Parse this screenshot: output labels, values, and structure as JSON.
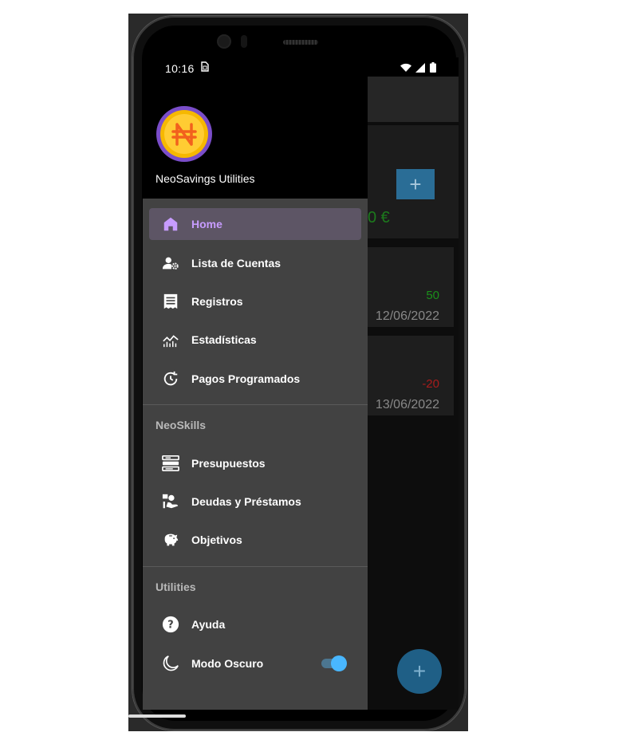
{
  "status_bar": {
    "time": "10:16",
    "sim_icon": "sim-card-icon",
    "icons": [
      "wifi-icon",
      "signal-icon",
      "battery-icon"
    ]
  },
  "drawer": {
    "app_name": "NeoSavings Utilities",
    "logo_icon": "naira-coin-icon",
    "items": [
      {
        "label": "Home",
        "icon": "home-icon",
        "active": true
      },
      {
        "label": "Lista de Cuentas",
        "icon": "accounts-settings-icon"
      },
      {
        "label": "Registros",
        "icon": "receipt-icon"
      },
      {
        "label": "Estadísticas",
        "icon": "chart-icon"
      },
      {
        "label": "Pagos Programados",
        "icon": "scheduled-clock-icon"
      }
    ],
    "sections": [
      {
        "title": "NeoSkills",
        "items": [
          {
            "label": "Presupuestos",
            "icon": "budget-icon"
          },
          {
            "label": "Deudas y Préstamos",
            "icon": "debt-loan-icon"
          },
          {
            "label": "Objetivos",
            "icon": "piggy-bank-icon"
          }
        ]
      },
      {
        "title": "Utilities",
        "items": [
          {
            "label": "Ayuda",
            "icon": "help-icon"
          },
          {
            "label": "Modo Oscuro",
            "icon": "moon-icon",
            "toggle": true
          }
        ]
      }
    ]
  },
  "background": {
    "add_label": "+",
    "amount": "0 €",
    "records": [
      {
        "value": "50",
        "date": "12/06/2022",
        "color": "#1a8f1a"
      },
      {
        "value": "-20",
        "date": "13/06/2022",
        "color": "#a81c1c"
      }
    ],
    "fab_label": "+"
  },
  "colors": {
    "accent": "#c79cff",
    "drawer_bg": "#424242",
    "toggle": "#49b7ff"
  }
}
